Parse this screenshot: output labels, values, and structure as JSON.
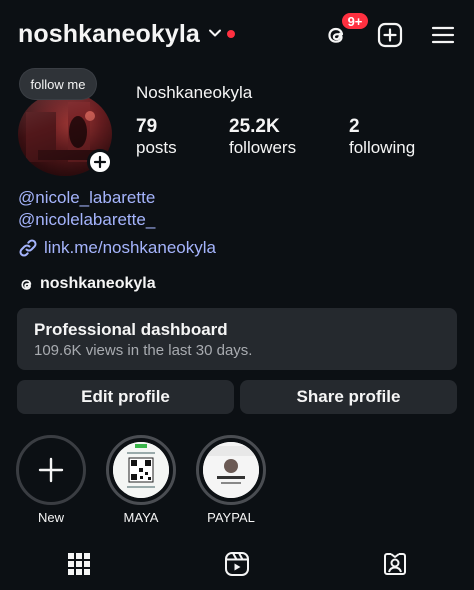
{
  "header": {
    "username": "noshkaneokyla",
    "notification_badge": "9+",
    "icons": [
      "chevron-down-icon",
      "threads-icon",
      "add-post-icon",
      "menu-icon"
    ],
    "accent_red": "#ff3040"
  },
  "profile": {
    "follow_bubble": "follow me",
    "display_name": "Noshkaneokyla",
    "stats": [
      {
        "number": "79",
        "label": "posts"
      },
      {
        "number": "25.2K",
        "label": "followers"
      },
      {
        "number": "2",
        "label": "following"
      }
    ],
    "mentions": [
      "@nicole_labarette",
      "@nicolelabarette_"
    ],
    "link": "link.me/noshkaneokyla",
    "threads_handle": "noshkaneokyla",
    "link_color": "#a5b4fc"
  },
  "dashboard": {
    "title": "Professional dashboard",
    "subtitle": "109.6K views in the last 30 days."
  },
  "buttons": {
    "edit": "Edit profile",
    "share": "Share profile"
  },
  "highlights": [
    {
      "label": "New"
    },
    {
      "label": "MAYA"
    },
    {
      "label": "PAYPAL"
    }
  ],
  "tabs": [
    "grid-icon",
    "reels-icon",
    "tagged-icon"
  ]
}
